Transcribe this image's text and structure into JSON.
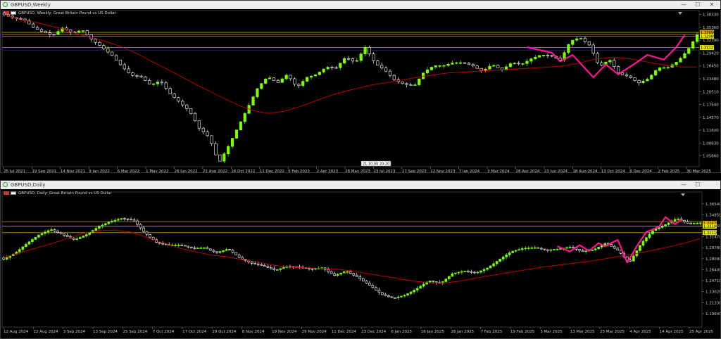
{
  "windows": [
    {
      "title": "GBPUSD,Weekly",
      "legend": "GBPUSD, Weekly:  Great Britain Pound vs US Dollar",
      "tooltip_time": "21.10.00 20:20"
    },
    {
      "title": "GBPUSD,Daily",
      "legend": "GBPUSD, Daily:  Great Britain Pound vs US Dollar"
    }
  ],
  "window_controls": {
    "minimize": "—",
    "maximize": "☐",
    "close": "✕"
  },
  "colors": {
    "bull": "#7CFC00",
    "bear": "#FFFFFF",
    "ma": "#CC0000",
    "hline": "#C8A000",
    "trend": "#FF1493",
    "blue_line": "#1E1EE6",
    "background": "#000000"
  },
  "chart_data": [
    {
      "type": "candlestick",
      "timeframe": "Weekly",
      "xlabel": "",
      "ylabel": "",
      "ylim": [
        1.0316,
        1.3925
      ],
      "y_ticks": [
        "1.38330",
        "1.35360",
        "1.32390",
        "1.29420",
        "1.26450",
        "1.23480",
        "1.20510",
        "1.17540",
        "1.14570",
        "1.11600",
        "1.08630",
        "1.05660"
      ],
      "x_ticks": [
        "25 Jul 2021",
        "19 Sep 2021",
        "14 Nov 2021",
        "9 Jan 2022",
        "6 Mar 2022",
        "1 May 2022",
        "26 Jun 2022",
        "21 Aug 2022",
        "16 Oct 2022",
        "11 Dec 2022",
        "5 Feb 2023",
        "2 Apr 2023",
        "28 May 2023",
        "23 Jul 2023",
        "17 Sep 2023",
        "12 Nov 2023",
        "7 Jan 2024",
        "3 Mar 2024",
        "28 Apr 2024",
        "23 Jun 2024",
        "18 Aug 2024",
        "13 Oct 2024",
        "8 Dec 2024",
        "2 Feb 2025",
        "30 Mar 2025"
      ],
      "anchors": [
        1.383,
        1.375,
        1.372,
        1.353,
        1.343,
        1.335,
        1.353,
        1.34,
        1.348,
        1.325,
        1.308,
        1.29,
        1.265,
        1.243,
        1.24,
        1.22,
        1.23,
        1.2,
        1.18,
        1.16,
        1.12,
        1.1,
        1.04,
        1.08,
        1.125,
        1.17,
        1.215,
        1.24,
        1.225,
        1.245,
        1.215,
        1.238,
        1.245,
        1.262,
        1.26,
        1.285,
        1.272,
        1.308,
        1.27,
        1.255,
        1.232,
        1.222,
        1.218,
        1.25,
        1.265,
        1.265,
        1.272,
        1.272,
        1.265,
        1.252,
        1.268,
        1.255,
        1.272,
        1.268,
        1.281,
        1.29,
        1.288,
        1.278,
        1.322,
        1.33,
        1.312,
        1.262,
        1.28,
        1.246,
        1.24,
        1.225,
        1.235,
        1.26,
        1.261,
        1.275,
        1.3,
        1.336
      ],
      "ma_anchors": [
        1.383,
        1.372,
        1.366,
        1.358,
        1.35,
        1.338,
        1.33,
        1.32,
        1.308,
        1.293,
        1.275,
        1.258,
        1.24,
        1.222,
        1.205,
        1.188,
        1.172,
        1.16,
        1.155,
        1.16,
        1.17,
        1.182,
        1.195,
        1.205,
        1.213,
        1.221,
        1.226,
        1.232,
        1.238,
        1.243,
        1.248,
        1.25,
        1.252,
        1.254,
        1.256,
        1.258,
        1.26,
        1.262,
        1.265,
        1.271,
        1.28,
        1.284,
        1.283,
        1.278,
        1.271,
        1.266,
        1.262,
        1.262
      ],
      "hlines": [
        1.342,
        1.337,
        1.333,
        1.307
      ],
      "price_labels": [
        {
          "text": "1.33696",
          "value": 1.342
        },
        {
          "text": "1.32989",
          "value": 1.333
        },
        {
          "text": "1.31127",
          "value": 1.307
        }
      ],
      "trend_path": [
        [
          126,
          1.308
        ],
        [
          132,
          1.295
        ],
        [
          134,
          1.275
        ],
        [
          137,
          1.29
        ],
        [
          142,
          1.238
        ],
        [
          145,
          1.268
        ],
        [
          148,
          1.245
        ],
        [
          152,
          1.27
        ],
        [
          155,
          1.29
        ],
        [
          159,
          1.279
        ],
        [
          162,
          1.308
        ],
        [
          164,
          1.336
        ]
      ]
    },
    {
      "type": "candlestick",
      "timeframe": "Daily",
      "xlabel": "",
      "ylabel": "",
      "ylim": [
        1.1757,
        1.3836
      ],
      "y_ticks": [
        "1.36540",
        "1.34850",
        "1.33160",
        "1.31470",
        "1.29780",
        "1.28090",
        "1.26400",
        "1.24710",
        "1.23020",
        "1.21330",
        "1.19640"
      ],
      "x_ticks": [
        "12 Aug 2024",
        "22 Aug 2024",
        "3 Sep 2024",
        "13 Sep 2024",
        "25 Sep 2024",
        "7 Oct 2024",
        "17 Oct 2024",
        "29 Oct 2024",
        "8 Nov 2024",
        "19 Nov 2024",
        "29 Nov 2024",
        "11 Dec 2024",
        "23 Dec 2024",
        "6 Jan 2025",
        "16 Jan 2025",
        "28 Jan 2025",
        "7 Feb 2025",
        "19 Feb 2025",
        "3 Mar 2025",
        "13 Mar 2025",
        "25 Mar 2025",
        "4 Apr 2025",
        "14 Apr 2025",
        "25 Apr 2025"
      ],
      "anchors": [
        1.28,
        1.29,
        1.305,
        1.318,
        1.326,
        1.318,
        1.31,
        1.318,
        1.33,
        1.338,
        1.343,
        1.34,
        1.32,
        1.305,
        1.302,
        1.302,
        1.297,
        1.298,
        1.29,
        1.296,
        1.282,
        1.274,
        1.27,
        1.263,
        1.269,
        1.268,
        1.265,
        1.267,
        1.255,
        1.262,
        1.252,
        1.24,
        1.226,
        1.22,
        1.225,
        1.235,
        1.247,
        1.243,
        1.258,
        1.262,
        1.259,
        1.267,
        1.28,
        1.292,
        1.297,
        1.298,
        1.294,
        1.296,
        1.299,
        1.292,
        1.295,
        1.305,
        1.294,
        1.275,
        1.305,
        1.325,
        1.333,
        1.343,
        1.335,
        1.336
      ],
      "ma_anchors": [
        1.282,
        1.29,
        1.297,
        1.304,
        1.312,
        1.32,
        1.324,
        1.325,
        1.322,
        1.314,
        1.306,
        1.298,
        1.292,
        1.287,
        1.284,
        1.28,
        1.276,
        1.271,
        1.268,
        1.267,
        1.266,
        1.265,
        1.262,
        1.258,
        1.254,
        1.25,
        1.246,
        1.244,
        1.244,
        1.247,
        1.252,
        1.256,
        1.26,
        1.264,
        1.268,
        1.271,
        1.274,
        1.277,
        1.281,
        1.285,
        1.289,
        1.294,
        1.299,
        1.305,
        1.312
      ],
      "hlines": [
        1.338,
        1.331,
        1.321
      ],
      "price_labels": [
        {
          "text": "1.33637",
          "value": 1.3355
        },
        {
          "text": "1.33100",
          "value": 1.331
        },
        {
          "text": "1.32110",
          "value": 1.3211
        }
      ],
      "trend_path": [
        [
          174,
          1.3
        ],
        [
          178,
          1.292
        ],
        [
          181,
          1.302
        ],
        [
          184,
          1.293
        ],
        [
          187,
          1.305
        ],
        [
          189,
          1.3
        ],
        [
          193,
          1.31
        ],
        [
          196,
          1.275
        ],
        [
          199,
          1.3
        ],
        [
          202,
          1.322
        ],
        [
          206,
          1.33
        ],
        [
          208,
          1.345
        ],
        [
          211,
          1.334
        ],
        [
          213,
          1.341
        ]
      ]
    }
  ]
}
